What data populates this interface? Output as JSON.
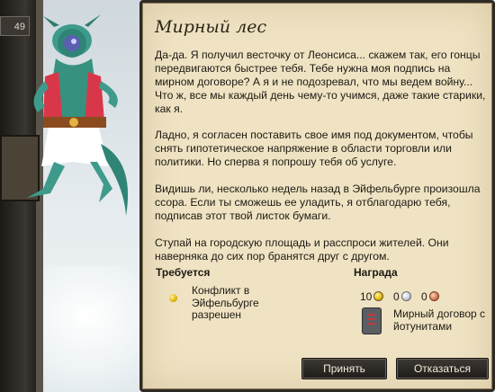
{
  "hud": {
    "counter_value": "49"
  },
  "quest": {
    "title": "Мирный лес",
    "paragraphs": [
      "Да-да. Я получил весточку от Леонсиса... скажем так, его гонцы передвигаются быстрее тебя. Тебе нужна моя подпись на мирном договоре? А я и не подозревал, что мы ведем войну... Что ж, все мы каждый день чему-то учимся, даже такие старики, как я.",
      "Ладно, я согласен поставить свое имя под документом, чтобы снять гипотетическое напряжение в области торговли или политики. Но сперва я попрошу тебя об услуге.",
      "Видишь ли, несколько недель назад в Эйфельбурге произошла ссора. Если ты сможешь ее уладить, я отблагодарю тебя, подписав этот твой листок бумаги.",
      "Ступай на городскую площадь и расспроси жителей. Они наверняка до сих пор бранятся друг с другом."
    ],
    "requirements": {
      "label": "Требуется",
      "item": "Конфликт в Эйфельбурге разрешен"
    },
    "reward": {
      "label": "Награда",
      "gold": "10",
      "silver": "0",
      "copper": "0",
      "item": "Мирный договор с йотунитами"
    },
    "buttons": {
      "accept": "Принять",
      "decline": "Отказаться"
    }
  },
  "colors": {
    "parchment": "#efe3c3",
    "frame": "#2e2a24",
    "button": "#2a2622",
    "button_text": "#f2ecdc"
  }
}
